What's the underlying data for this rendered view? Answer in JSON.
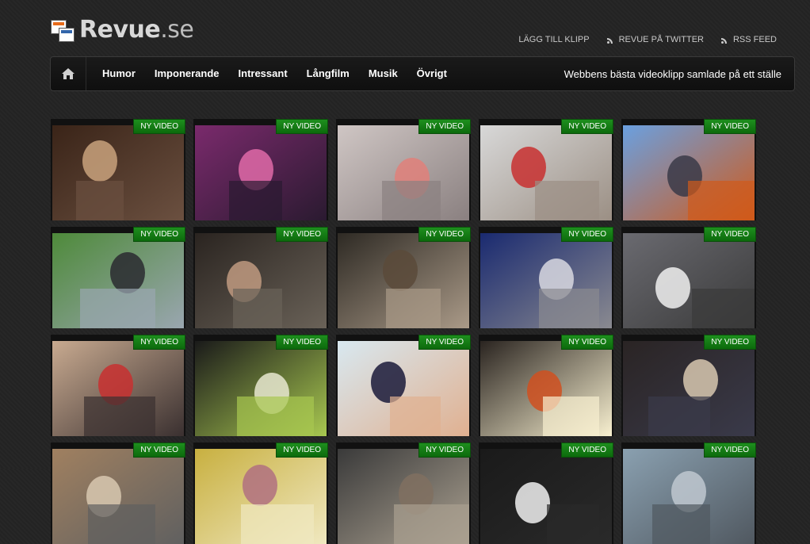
{
  "site": {
    "name_bold": "Revue",
    "name_rest": ".se"
  },
  "toplinks": [
    {
      "label": "LÄGG TILL KLIPP",
      "icon": "none"
    },
    {
      "label": "REVUE PÅ TWITTER",
      "icon": "rss-icon"
    },
    {
      "label": "RSS FEED",
      "icon": "rss-icon"
    }
  ],
  "nav": {
    "items": [
      "Humor",
      "Imponerande",
      "Intressant",
      "Långfilm",
      "Musik",
      "Övrigt"
    ],
    "tagline": "Webbens bästa videoklipp samlade på ett ställe"
  },
  "badge_label": "NY VIDEO",
  "thumbnails": [
    {
      "scene": "talk-show-two-men",
      "colors": [
        "#3a2418",
        "#c9a27d",
        "#6b5040"
      ]
    },
    {
      "scene": "man-colorful-stage",
      "colors": [
        "#7a2a6c",
        "#e06aa8",
        "#2a1a30"
      ]
    },
    {
      "scene": "pink-wave-sculpture",
      "colors": [
        "#cfc6c4",
        "#e0807a",
        "#8a8080"
      ]
    },
    {
      "scene": "bedroom-red-figure",
      "colors": [
        "#d8d8d8",
        "#c83030",
        "#9b8f84"
      ]
    },
    {
      "scene": "cannon-field",
      "colors": [
        "#6aa0e0",
        "#3a3a48",
        "#d05a1a"
      ]
    },
    {
      "scene": "model-jet-lawn",
      "colors": [
        "#4e8a3a",
        "#2a2a30",
        "#9aa6b0"
      ]
    },
    {
      "scene": "man-laughing",
      "colors": [
        "#2a2420",
        "#c09a80",
        "#6a6258"
      ]
    },
    {
      "scene": "couple-dark-room",
      "colors": [
        "#2e2a24",
        "#5a4a3a",
        "#aa9a88"
      ]
    },
    {
      "scene": "presenter-machine",
      "colors": [
        "#1a2a70",
        "#d8d8e0",
        "#8a8a90"
      ]
    },
    {
      "scene": "man-basketball-chair",
      "colors": [
        "#6a6a70",
        "#f0f0f0",
        "#3a3a3a"
      ]
    },
    {
      "scene": "guitar-player",
      "colors": [
        "#c8aa90",
        "#c83030",
        "#3a3030"
      ]
    },
    {
      "scene": "painting-face",
      "colors": [
        "#1a1a1a",
        "#e8e8d0",
        "#a8c850"
      ]
    },
    {
      "scene": "girl-singing",
      "colors": [
        "#d8e8f0",
        "#1a1a3a",
        "#e0b090"
      ]
    },
    {
      "scene": "police-car-night",
      "colors": [
        "#2a2420",
        "#d05020",
        "#f8f0d0"
      ]
    },
    {
      "scene": "man-woman-gala",
      "colors": [
        "#2a2424",
        "#d8c8b0",
        "#3a3a4a"
      ]
    },
    {
      "scene": "row4-a",
      "colors": [
        "#a08060",
        "#d8c8b0",
        "#606060"
      ]
    },
    {
      "scene": "row4-b",
      "colors": [
        "#c8b040",
        "#b07080",
        "#f0e8c0"
      ]
    },
    {
      "scene": "row4-c",
      "colors": [
        "#3a3a3a",
        "#807060",
        "#aaa090"
      ]
    },
    {
      "scene": "row4-d",
      "colors": [
        "#1a1a1a",
        "#f0f0f0",
        "#2a2a2a"
      ]
    },
    {
      "scene": "row4-e",
      "colors": [
        "#8aa0b0",
        "#c0c8d0",
        "#505860"
      ]
    }
  ]
}
